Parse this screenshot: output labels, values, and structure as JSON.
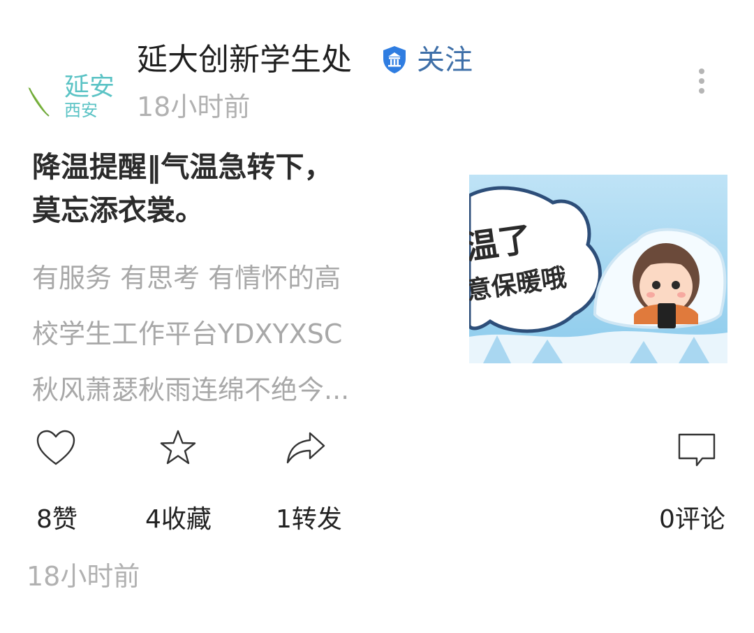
{
  "account": {
    "logo_text_line1": "延安",
    "logo_text_line2": "西安",
    "name": "延大创新学生处",
    "verified": true,
    "follow_label": "关注",
    "time": "18小时前"
  },
  "article": {
    "title_line1": "降温提醒‖气温急转下，",
    "title_line2": "莫忘添衣裳。",
    "summary_line1": "有服务 有思考 有情怀的高",
    "summary_line2": "校学生工作平台YDXYXSC",
    "summary_line3": "秋风萧瑟秋雨连绵不绝今...",
    "cover_text_line1": "温了",
    "cover_text_line2": "意保暖哦"
  },
  "actions": {
    "like": {
      "icon": "heart-icon",
      "label": "8赞"
    },
    "favorite": {
      "icon": "star-icon",
      "label": "4收藏"
    },
    "share": {
      "icon": "share-arrow-icon",
      "label": "1转发"
    },
    "comment": {
      "icon": "comment-bubble-icon",
      "label": "0评论"
    }
  },
  "footer": {
    "time": "18小时前"
  },
  "colors": {
    "follow": "#3e6fa8",
    "badge": "#2f7de1",
    "muted": "#b1b1b1",
    "logo_teal": "#5bc3c5",
    "logo_green": "#8bc34a"
  }
}
